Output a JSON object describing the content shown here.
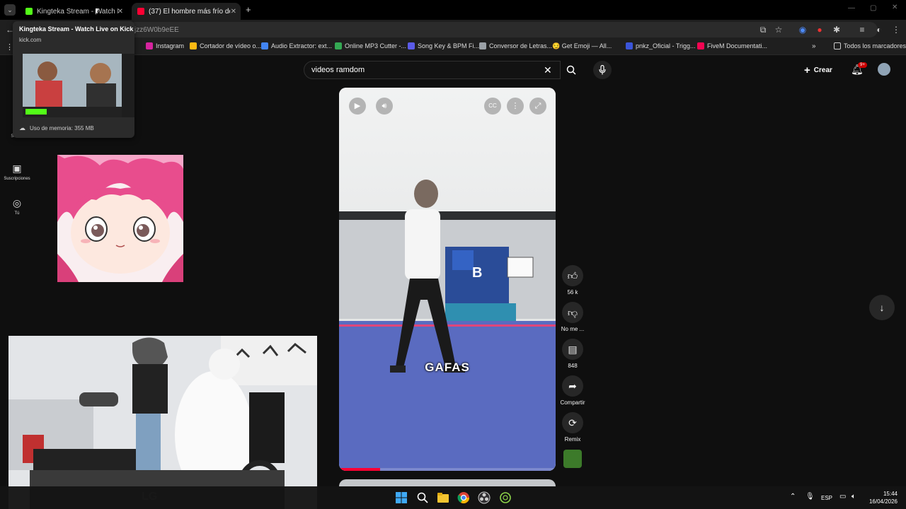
{
  "browser": {
    "tabs": [
      {
        "title": "Kingteka Stream - Watch Live on Kick",
        "active": false
      },
      {
        "title": "(37) El hombre más frío de la historia",
        "active": true
      }
    ],
    "url_fragment": "jzz6W0b9eEE",
    "bookmarks": [
      "Instagram",
      "Cortador de vídeo o...",
      "Audio Extractor: ext...",
      "Online MP3 Cutter -...",
      "Song Key & BPM Fi...",
      "Conversor de Letras...",
      "😏 Get Emoji — All...",
      "pnkz_Oficial - Trigg...",
      "FiveM Documentati..."
    ],
    "bookmarks_all": "Todos los marcadores"
  },
  "hovercard": {
    "title": "Kingteka Stream - Watch Live on Kick",
    "domain": "kick.com",
    "memory": "Uso de memoria: 355 MB"
  },
  "youtube": {
    "rail": [
      {
        "label": "Shorts",
        "icon": "shorts-icon"
      },
      {
        "label": "Suscripciones",
        "icon": "subscriptions-icon"
      },
      {
        "label": "Tú",
        "icon": "you-icon"
      }
    ],
    "search_value": "videos ramdom",
    "create_label": "Crear",
    "notifications_badge": "9+",
    "video": {
      "caption": "GAFAS",
      "progress": 0.19,
      "sign_letter": "B"
    },
    "actions": {
      "likes": "56 k",
      "dislike": "No me ...",
      "comments": "848",
      "share": "Compartir",
      "remix": "Remix"
    }
  },
  "webcam": {
    "monitor_brand": "LG"
  },
  "taskbar": {
    "lang": "ESP",
    "time": "15:44",
    "date": "16/04/2026"
  },
  "colors": {
    "accent_red": "#ff0033",
    "badge_red": "#cc0000",
    "kick_green": "#53fc18"
  }
}
